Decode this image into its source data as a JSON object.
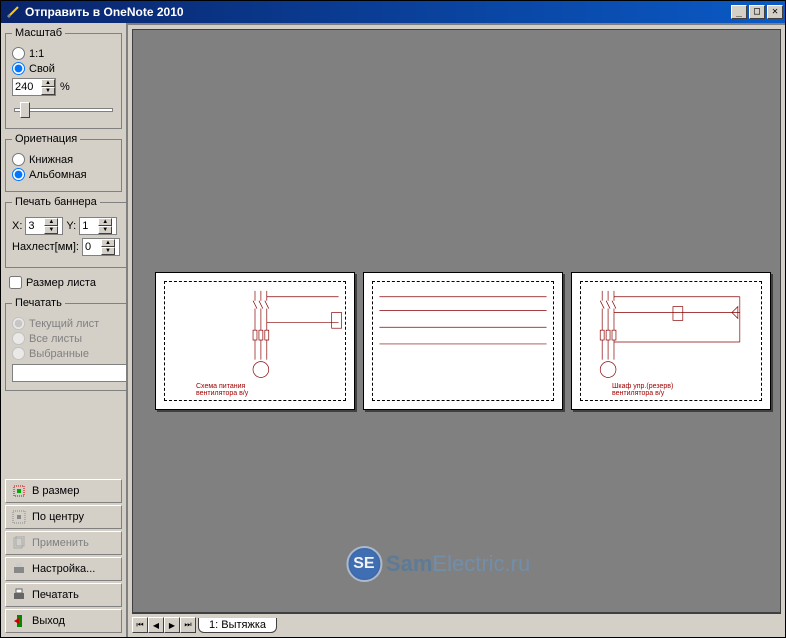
{
  "window": {
    "title": "Отправить в OneNote 2010"
  },
  "sidebar": {
    "scale": {
      "legend": "Масштаб",
      "opt_1to1": "1:1",
      "opt_custom": "Свой",
      "value": "240",
      "percent": "%"
    },
    "orientation": {
      "legend": "Ориетнация",
      "opt_portrait": "Книжная",
      "opt_landscape": "Альбомная"
    },
    "banner": {
      "legend": "Печать баннера",
      "x_label": "X:",
      "x_value": "3",
      "y_label": "Y:",
      "y_value": "1",
      "overlap_label": "Нахлест[мм]:",
      "overlap_value": "0"
    },
    "sheet_size_label": "Размер листа",
    "print": {
      "legend": "Печатать",
      "opt_current": "Текущий лист",
      "opt_all": "Все листы",
      "opt_selected": "Выбранные"
    },
    "buttons": {
      "fit": "В размер",
      "center": "По центру",
      "apply": "Применить",
      "settings": "Настройка...",
      "print_btn": "Печатать",
      "exit": "Выход"
    }
  },
  "tabs": {
    "tab1": "1: Вытяжка"
  },
  "watermark": {
    "badge": "SE",
    "prefix": "Sam",
    "suffix": "Electric.ru"
  },
  "help": "?"
}
